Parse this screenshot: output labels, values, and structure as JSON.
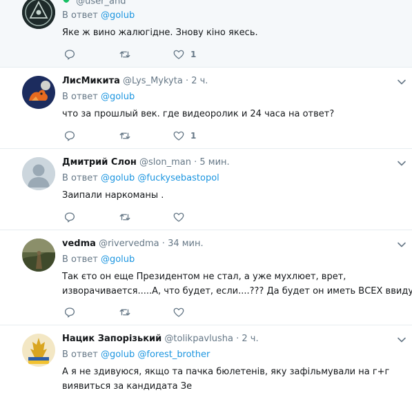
{
  "tweets": [
    {
      "handle": "@user_and",
      "reply_prefix": "В ответ",
      "mentions": [
        "@golub"
      ],
      "text": "Яке ж вино жалюгідне. Знову кіно якесь.",
      "like_count": "1"
    },
    {
      "name": "ЛисМикита",
      "handle": "@Lys_Mykyta",
      "time": "2 ч.",
      "reply_prefix": "В ответ",
      "mentions": [
        "@golub"
      ],
      "text": "что за прошлый век. где видеоролик и 24 часа на ответ?",
      "like_count": "1"
    },
    {
      "name": "Дмитрий Слон",
      "handle": "@slon_man",
      "time": "5 мин.",
      "reply_prefix": "В ответ",
      "mentions": [
        "@golub",
        "@fuckysebastopol"
      ],
      "text": "Заипали наркоманы .",
      "like_count": ""
    },
    {
      "name": "vedma",
      "handle": "@rivervedma",
      "time": "34 мин.",
      "reply_prefix": "В ответ",
      "mentions": [
        "@golub"
      ],
      "text_line1": "Так єто он еще Президентом не стал, а уже мухлюет, врет,",
      "text_line2": "изворачивается.....А, что будет, если....??? Да будет он иметь ВСЕХ ввиду...",
      "like_count": ""
    },
    {
      "name": "Нацик Запорізький",
      "handle": "@tolikpavlusha",
      "time": "2 ч.",
      "reply_prefix": "В ответ",
      "mentions": [
        "@golub",
        "@forest_brother"
      ],
      "text_line1": "А я не здивуюся, якщо та пачка бюлетенів, яку зафільмували на г+г",
      "text_line2": "виявиться за кандидата Зе"
    }
  ],
  "separator": "·",
  "colors": {
    "link": "#1b95e0",
    "secondary": "#657786",
    "highlight_bg": "#f5f8fa",
    "divider": "#e6ecf0"
  },
  "icons": [
    "reply-icon",
    "retweet-icon",
    "like-icon",
    "chevron-down-icon",
    "verified-shield-icon"
  ]
}
